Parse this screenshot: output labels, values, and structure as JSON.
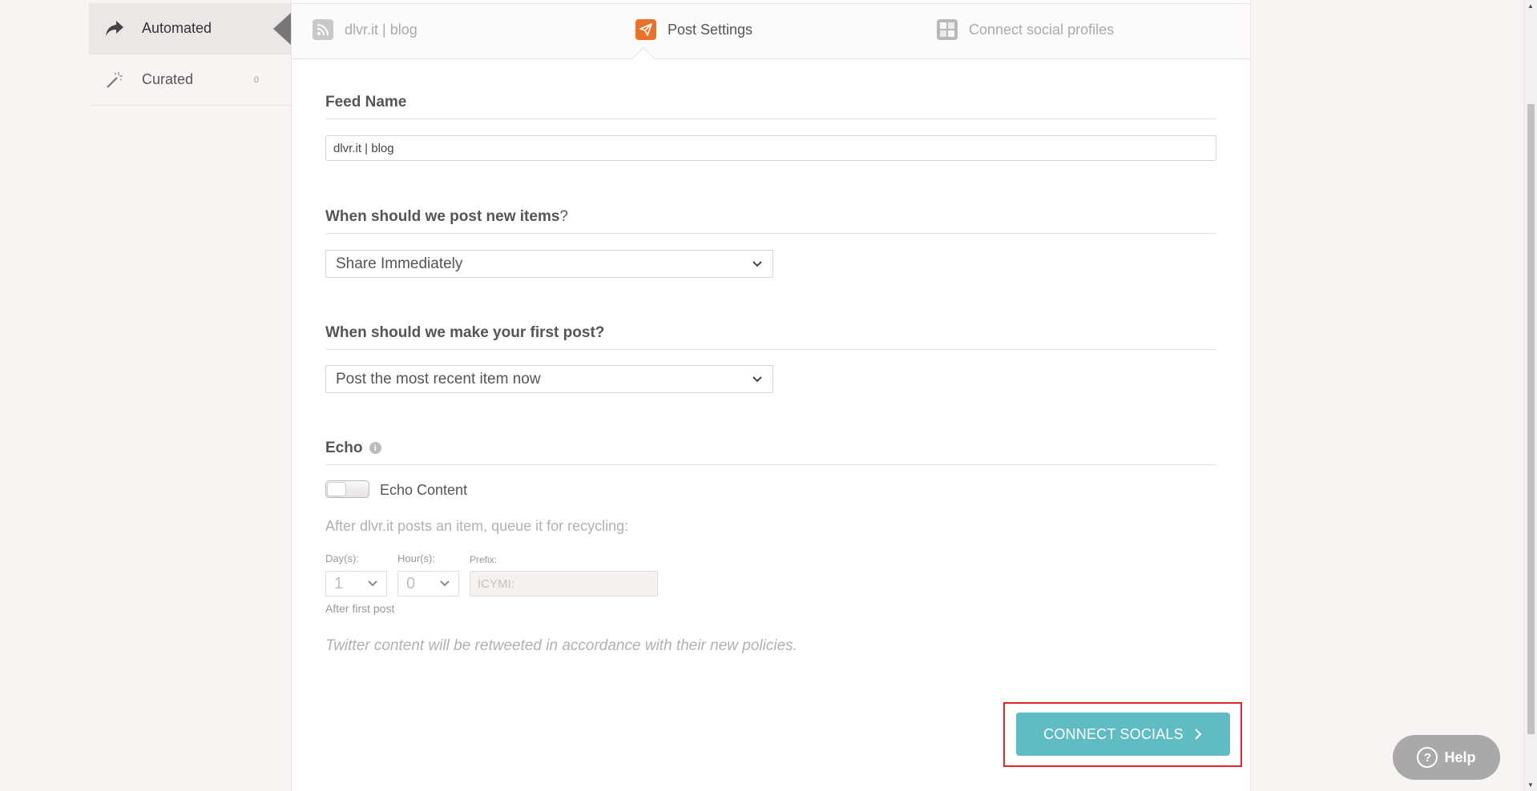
{
  "sidebar": {
    "items": [
      {
        "label": "Automated",
        "icon": "share-arrow-icon",
        "active": true
      },
      {
        "label": "Curated",
        "icon": "magic-wand-icon",
        "badge": "0"
      }
    ]
  },
  "steps": [
    {
      "label": "dlvr.it | blog",
      "icon": "rss-icon"
    },
    {
      "label": "Post Settings",
      "icon": "paper-plane-icon",
      "current": true
    },
    {
      "label": "Connect social profiles",
      "icon": "social-grid-icon"
    }
  ],
  "form": {
    "feed_name_label": "Feed Name",
    "feed_name_value": "dlvr.it | blog",
    "when_post_label": "When should we post new items",
    "when_post_q": "?",
    "when_post_value": "Share Immediately",
    "first_post_label": "When should we make your first post?",
    "first_post_value": "Post the most recent item now",
    "echo_label": "Echo",
    "echo_toggle_label": "Echo Content",
    "echo_desc": "After dlvr.it posts an item, queue it for recycling:",
    "days_label": "Day(s):",
    "days_value": "1",
    "hours_label": "Hour(s):",
    "hours_value": "0",
    "prefix_label": "Prefix:",
    "prefix_placeholder": "ICYMI:",
    "after_first": "After first post",
    "twitter_note": "Twitter content will be retweeted in accordance with their new policies."
  },
  "connect_button": "CONNECT SOCIALS",
  "help_button": "Help",
  "colors": {
    "accent_teal": "#5fbcc2",
    "post_settings_orange": "#e8722a",
    "highlight_red": "#e0242b"
  }
}
